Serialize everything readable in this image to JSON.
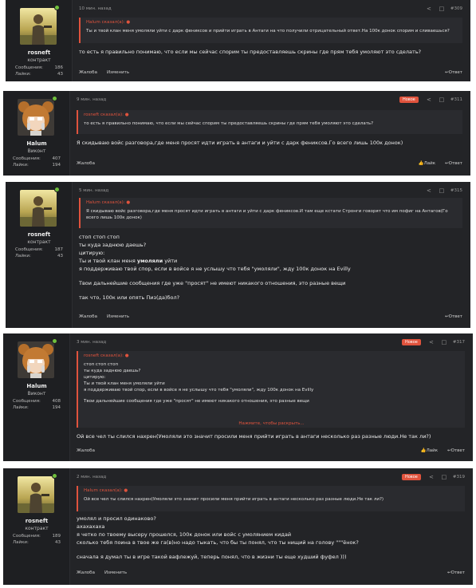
{
  "icons": {
    "share": "share-icon",
    "bookmark": "bookmark-icon",
    "like": "thumbs-up-icon",
    "reply": "reply-icon",
    "online": "online-dot-icon"
  },
  "colors": {
    "accent": "#e0533d",
    "online": "#6fbf3c",
    "post_bg": "#232427",
    "user_bg": "#1e1f22"
  },
  "posts": [
    {
      "user": {
        "name": "rosneft",
        "title": "контракт",
        "messages_label": "Сообщения:",
        "messages": "186",
        "likes_label": "Лайки:",
        "likes": "43"
      },
      "time": "10 мин. назад",
      "number": "#309",
      "quote_author": "Halum сказал(а):",
      "quote_lines": [
        "Ты и твой клан меня умоляли уйти с дарк фениксов и прийти играть в Антаги на что получили отрицательный ответ.На 100к донок спорим и сливаешься?"
      ],
      "body": [
        "то есть я правильно понимаю, что если мы сейчас спорим ты предоставляешь скрины где прям тебя умоляют это сделать?"
      ],
      "footer": {
        "report": "Жалоба",
        "edit": "Изменить",
        "reply": "Ответ"
      }
    },
    {
      "user": {
        "name": "Halum",
        "title": "Виконт",
        "messages_label": "Сообщения:",
        "messages": "407",
        "likes_label": "Лайки:",
        "likes": "194"
      },
      "time": "9 мин. назад",
      "new_badge": "Новое",
      "number": "#311",
      "quote_author": "rosneft сказал(а):",
      "quote_lines": [
        "то есть я правильно понимаю, что если мы сейчас спорим ты предоставляешь скрины где прям тебя умоляют это сделать?"
      ],
      "body": [
        "Я скидываю войс разговора,где меня просят идти играть в антаги и уйти с дарк фениксов.Го всего лишь 100к донок)"
      ],
      "footer": {
        "report": "Жалоба",
        "like": "Лайк",
        "reply": "Ответ"
      }
    },
    {
      "user": {
        "name": "rosneft",
        "title": "контракт",
        "messages_label": "Сообщения:",
        "messages": "187",
        "likes_label": "Лайки:",
        "likes": "43"
      },
      "time": "5 мин. назад",
      "number": "#315",
      "quote_author": "Halum сказал(а):",
      "quote_lines": [
        "Я скидываю войс разговора,где меня просят идти играть в антаги и уйти с дарк фениксов.И там еще кстати Стронги говорят что им пофиг на Антагов(Го всего лишь 100к донок)"
      ],
      "body": [
        "стоп стоп стоп",
        "ты куда заднюю даешь?",
        "цитирую:",
        "Ты и твой клан меня умоляли уйти",
        "я поддерживаю твой спор, если в войсе я не услышу что тебя \"умоляли\", жду 100к донок на Evilly",
        "",
        "Твои дальнейшие сообщения где уже \"просят\" не имеют никакого отношения, это разные вещи",
        "",
        "так что, 100к или опять Пиз(да)бол?"
      ],
      "bold_word": "умоляли",
      "footer": {
        "report": "Жалоба",
        "edit": "Изменить",
        "reply": "Ответ"
      }
    },
    {
      "user": {
        "name": "Halum",
        "title": "Виконт",
        "messages_label": "Сообщения:",
        "messages": "408",
        "likes_label": "Лайки:",
        "likes": "194"
      },
      "time": "3 мин. назад",
      "new_badge": "Новое",
      "number": "#317",
      "quote_author": "rosneft сказал(а):",
      "quote_lines": [
        "стоп стоп стоп",
        "ты куда заднюю даешь?",
        "цитирую:",
        "Ты и твой клан меня умоляли уйти",
        "я поддерживаю твой спор, если в войсе я не услышу что тебя \"умоляли\", жду 100к донок на Evilly",
        "",
        "Твои дальнейшие сообщения где уже \"просят\" не имеют никакого отношения, это разные вещи"
      ],
      "expand": "Нажмите, чтобы раскрыть...",
      "body": [
        "Ой все чел ты слился нахрен(Умоляли это значит просили меня прийти играть в антаги несколько раз разные люди.Не так ли?)"
      ],
      "footer": {
        "report": "Жалоба",
        "like": "Лайк",
        "reply": "Ответ"
      }
    },
    {
      "user": {
        "name": "rosneft",
        "title": "контракт",
        "messages_label": "Сообщения:",
        "messages": "189",
        "likes_label": "Лайки:",
        "likes": "43"
      },
      "time": "2 мин. назад",
      "new_badge": "Новое",
      "number": "#319",
      "quote_author": "Halum сказал(а):",
      "quote_lines": [
        "Ой все чел ты слился нахрен(Умоляли это значит просили меня прийти играть в антаги несколько раз разные люди.Не так ли?)"
      ],
      "body": [
        "умолял и просил одинаково?",
        "ахахахаха",
        "я четко по твоему высеру прошелся, 100к донок или войс с умолянием кидай",
        "сколько тебя поина в твое же га(в)но надо тыкать, что бы ты понял, что ты нищий на голову \"\"\"ёнок?",
        "",
        "сначала я думал ты в игре такой вафлежуй, теперь понял, что в жизни ты еще худший фуфел )))"
      ],
      "footer": {
        "report": "Жалоба",
        "edit": "Изменить",
        "reply": "Ответ"
      }
    }
  ]
}
